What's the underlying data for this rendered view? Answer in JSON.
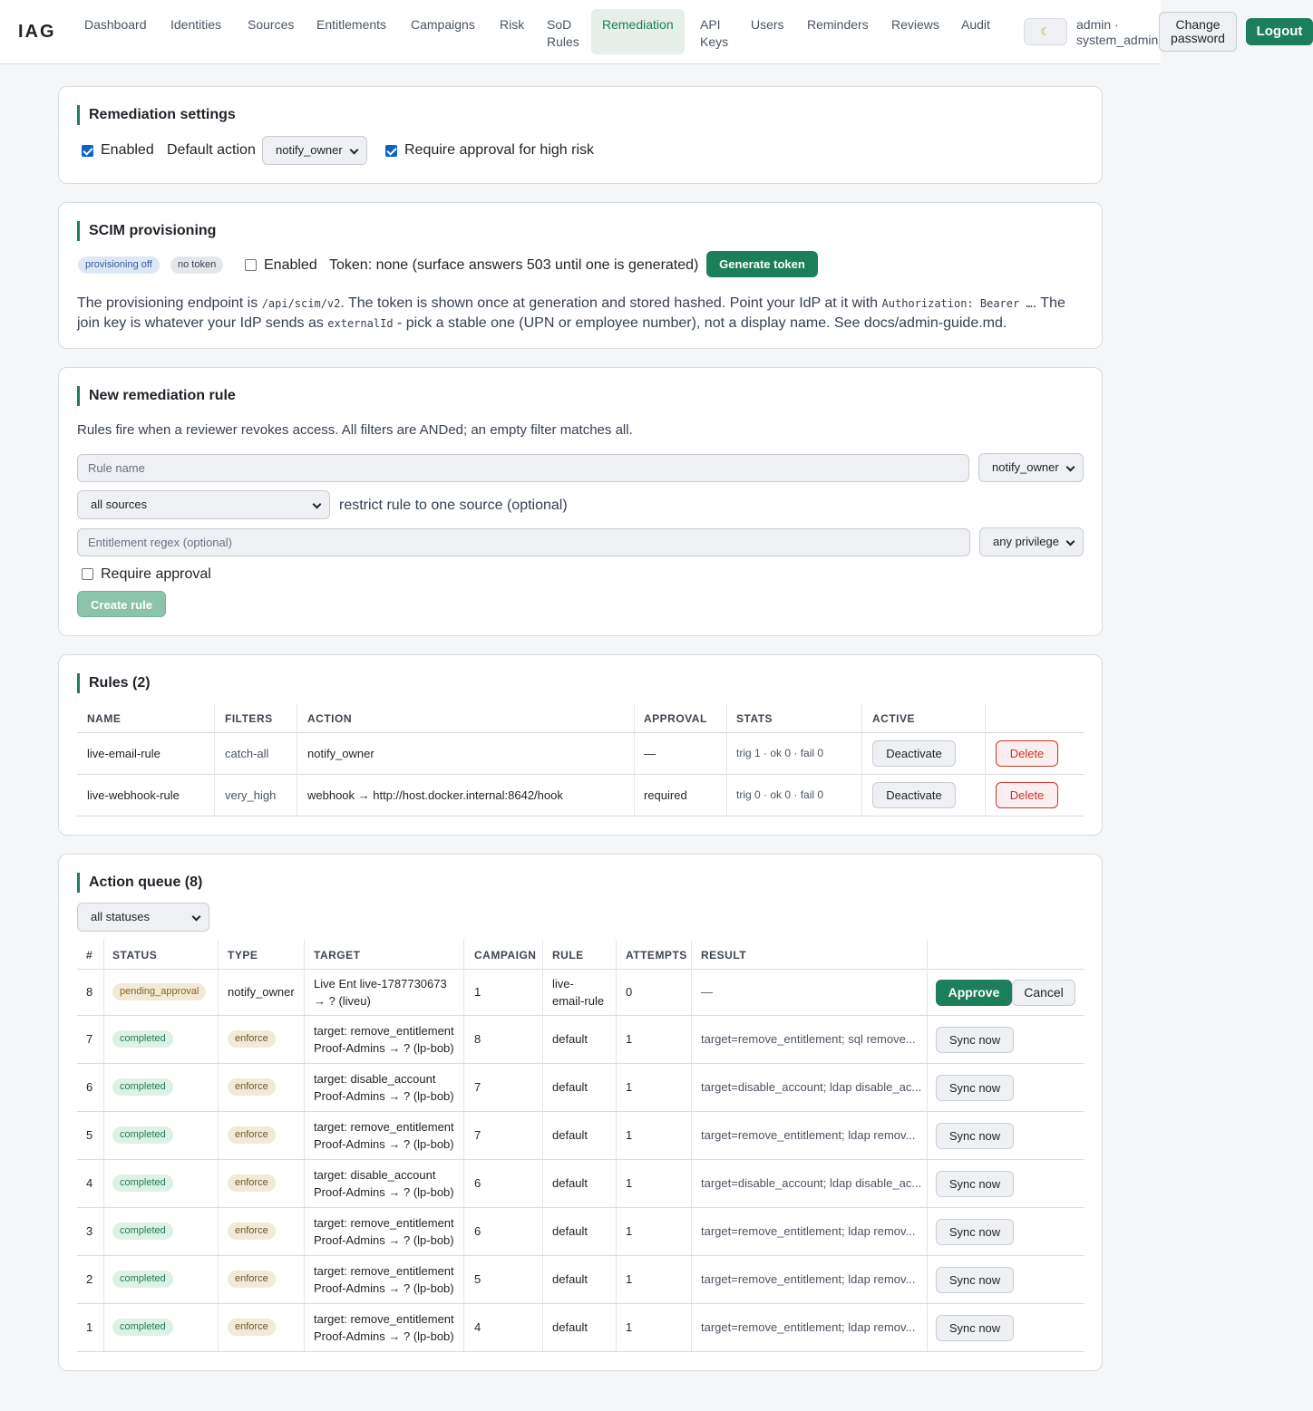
{
  "brand": "IAG",
  "nav": [
    {
      "label": "Dashboard"
    },
    {
      "label": "Identities"
    },
    {
      "label": "Sources"
    },
    {
      "label": "Entitlements"
    },
    {
      "label": "Campaigns"
    },
    {
      "label": "Risk"
    },
    {
      "label": "SoD Rules"
    },
    {
      "label": "Remediation"
    },
    {
      "label": "API Keys"
    },
    {
      "label": "Users"
    },
    {
      "label": "Reminders"
    },
    {
      "label": "Reviews"
    },
    {
      "label": "Audit"
    }
  ],
  "header": {
    "theme_icon": "moon-icon",
    "user_line1": "admin ·",
    "user_line2": "system_admin",
    "change_password": "Change password",
    "logout": "Logout"
  },
  "settings": {
    "title": "Remediation settings",
    "enabled_label": "Enabled",
    "enabled_checked": true,
    "default_action_label": "Default action",
    "default_action_value": "notify_owner",
    "require_approval_label": "Require approval for high risk",
    "require_approval_checked": true
  },
  "scim": {
    "title": "SCIM provisioning",
    "badge_provisioning": "provisioning off",
    "badge_token": "no token",
    "enabled_label": "Enabled",
    "enabled_checked": false,
    "token_status": "Token: none (surface answers 503 until one is generated)",
    "generate_button": "Generate token",
    "desc_1": "The provisioning endpoint is ",
    "desc_code_1": "/api/scim/v2",
    "desc_2": ". The token is shown once at generation and stored hashed. Point your IdP at it with ",
    "desc_code_2": "Authorization: Bearer …",
    "desc_3": ". The join key is whatever your IdP sends as ",
    "desc_code_3": "externalId",
    "desc_4": " - pick a stable one (UPN or employee number), not a display name. See docs/admin-guide.md."
  },
  "new_rule": {
    "title": "New remediation rule",
    "desc": "Rules fire when a reviewer revokes access. All filters are ANDed; an empty filter matches all.",
    "name_placeholder": "Rule name",
    "action_value": "notify_owner",
    "source_value": "all sources",
    "source_hint": "restrict rule to one source (optional)",
    "regex_placeholder": "Entitlement regex (optional)",
    "privilege_value": "any privilege",
    "require_approval_label": "Require approval",
    "require_approval_checked": false,
    "create_button": "Create rule"
  },
  "rules": {
    "title": "Rules (2)",
    "columns": [
      "NAME",
      "FILTERS",
      "ACTION",
      "APPROVAL",
      "STATS",
      "ACTIVE"
    ],
    "rows": [
      {
        "name": "live-email-rule",
        "filters": "catch-all",
        "action": "notify_owner",
        "approval": "—",
        "stats": "trig 1 · ok 0 · fail 0",
        "active_button": "Deactivate",
        "delete_button": "Delete"
      },
      {
        "name": "live-webhook-rule",
        "filters": "very_high",
        "action": "webhook → http://host.docker.internal:8642/hook",
        "approval": "required",
        "stats": "trig 0 · ok 0 · fail 0",
        "active_button": "Deactivate",
        "delete_button": "Delete"
      }
    ]
  },
  "queue": {
    "title": "Action queue (8)",
    "filter_value": "all statuses",
    "columns": [
      "#",
      "STATUS",
      "TYPE",
      "TARGET",
      "CAMPAIGN",
      "RULE",
      "ATTEMPTS",
      "RESULT"
    ],
    "rows": [
      {
        "id": "8",
        "status": "pending_approval",
        "type": "notify_owner",
        "target1": "Live Ent live-1787730673",
        "target2": "→ ? (liveu)",
        "campaign": "1",
        "rule1": "live-",
        "rule2": "email-rule",
        "attempts": "0",
        "result": "—",
        "approve": "Approve",
        "cancel": "Cancel"
      },
      {
        "id": "7",
        "status": "completed",
        "type": "enforce",
        "target1": "target: remove_entitlement",
        "target2": "Proof-Admins → ? (lp-bob)",
        "campaign": "8",
        "rule": "default",
        "attempts": "1",
        "result": "target=remove_entitlement; sql remove...",
        "sync": "Sync now"
      },
      {
        "id": "6",
        "status": "completed",
        "type": "enforce",
        "target1": "target: disable_account",
        "target2": "Proof-Admins → ? (lp-bob)",
        "campaign": "7",
        "rule": "default",
        "attempts": "1",
        "result": "target=disable_account; ldap disable_ac...",
        "sync": "Sync now"
      },
      {
        "id": "5",
        "status": "completed",
        "type": "enforce",
        "target1": "target: remove_entitlement",
        "target2": "Proof-Admins → ? (lp-bob)",
        "campaign": "7",
        "rule": "default",
        "attempts": "1",
        "result": "target=remove_entitlement; ldap remov...",
        "sync": "Sync now"
      },
      {
        "id": "4",
        "status": "completed",
        "type": "enforce",
        "target1": "target: disable_account",
        "target2": "Proof-Admins → ? (lp-bob)",
        "campaign": "6",
        "rule": "default",
        "attempts": "1",
        "result": "target=disable_account; ldap disable_ac...",
        "sync": "Sync now"
      },
      {
        "id": "3",
        "status": "completed",
        "type": "enforce",
        "target1": "target: remove_entitlement",
        "target2": "Proof-Admins → ? (lp-bob)",
        "campaign": "6",
        "rule": "default",
        "attempts": "1",
        "result": "target=remove_entitlement; ldap remov...",
        "sync": "Sync now"
      },
      {
        "id": "2",
        "status": "completed",
        "type": "enforce",
        "target1": "target: remove_entitlement",
        "target2": "Proof-Admins → ? (lp-bob)",
        "campaign": "5",
        "rule": "default",
        "attempts": "1",
        "result": "target=remove_entitlement; ldap remov...",
        "sync": "Sync now"
      },
      {
        "id": "1",
        "status": "completed",
        "type": "enforce",
        "target1": "target: remove_entitlement",
        "target2": "Proof-Admins → ? (lp-bob)",
        "campaign": "4",
        "rule": "default",
        "attempts": "1",
        "result": "target=remove_entitlement; ldap remov...",
        "sync": "Sync now"
      }
    ]
  }
}
